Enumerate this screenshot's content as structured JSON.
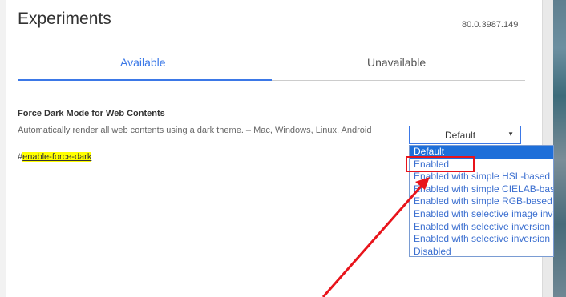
{
  "header": {
    "title": "Experiments",
    "version": "80.0.3987.149"
  },
  "tabs": [
    {
      "label": "Available",
      "active": true
    },
    {
      "label": "Unavailable",
      "active": false
    }
  ],
  "experiment": {
    "title": "Force Dark Mode for Web Contents",
    "description": "Automatically render all web contents using a dark theme. – Mac, Windows, Linux, Android",
    "link_prefix": "#",
    "link_text": "enable-force-dark",
    "select_value": "Default",
    "dropdown_arrow": "▼"
  },
  "dropdown": {
    "options": [
      "Default",
      "Enabled",
      "Enabled with simple HSL-based inversion",
      "Enabled with simple CIELAB-based inversion",
      "Enabled with simple RGB-based inversion",
      "Enabled with selective image inversion",
      "Enabled with selective inversion of non-image elements",
      "Enabled with selective inversion of everything",
      "Disabled"
    ],
    "selected_index": 0
  },
  "annotation": {
    "highlight_color": "#e8141b",
    "highlighted_option": "Enabled"
  },
  "colors": {
    "accent": "#3b78e7",
    "link_highlight": "#ffff00"
  }
}
